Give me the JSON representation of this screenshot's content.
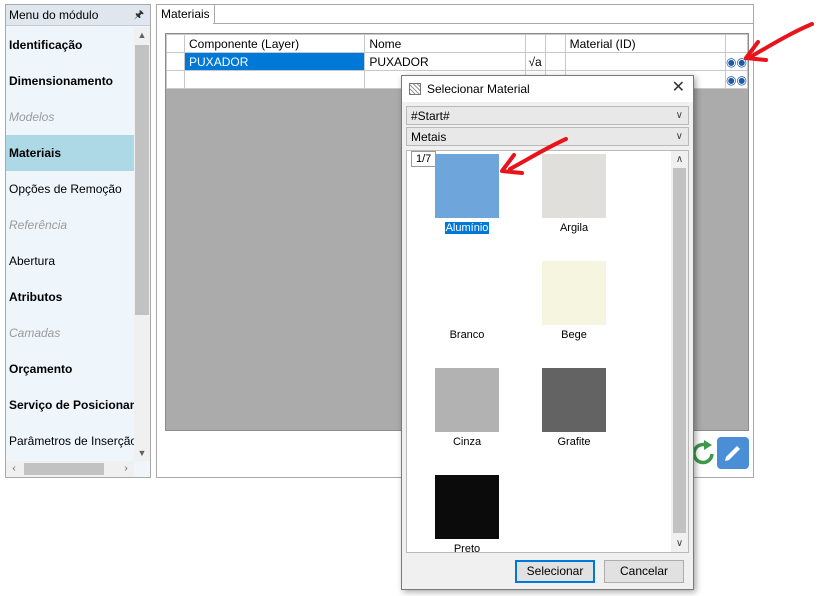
{
  "sidebar": {
    "title": "Menu do módulo",
    "items": [
      {
        "label": "Identificação",
        "style": "bold"
      },
      {
        "label": "Dimensionamento",
        "style": "bold"
      },
      {
        "label": "Modelos",
        "style": "disabled"
      },
      {
        "label": "Materiais",
        "style": "selected"
      },
      {
        "label": "Opções de Remoção",
        "style": "normal"
      },
      {
        "label": "Referência",
        "style": "disabled"
      },
      {
        "label": "Abertura",
        "style": "normal"
      },
      {
        "label": "Atributos",
        "style": "bold"
      },
      {
        "label": "Camadas",
        "style": "disabled"
      },
      {
        "label": "Orçamento",
        "style": "bold"
      },
      {
        "label": "Serviço de Posicionamento",
        "style": "bold"
      },
      {
        "label": "Parâmetros de Inserção",
        "style": "normal"
      }
    ]
  },
  "main": {
    "tab": "Materiais",
    "grid": {
      "columns": [
        "Componente (Layer)",
        "Nome",
        "",
        "",
        "Material (ID)",
        ""
      ],
      "rows": [
        {
          "component": "PUXADOR",
          "name": "PUXADOR",
          "material_id": ""
        }
      ]
    }
  },
  "dialog": {
    "title": "Selecionar Material",
    "combo1": "#Start#",
    "combo2": "Metais",
    "page_indicator": "1/7",
    "materials": [
      {
        "label": "Alumínio",
        "color": "#6ea6db",
        "selected": true
      },
      {
        "label": "Argila",
        "color": "#e0dfdc"
      },
      {
        "label": "Branco",
        "color": "#ffffff"
      },
      {
        "label": "Bege",
        "color": "#f5f5e0"
      },
      {
        "label": "Cinza",
        "color": "#b2b2b2"
      },
      {
        "label": "Grafite",
        "color": "#636363"
      },
      {
        "label": "Preto",
        "color": "#0b0b0b"
      }
    ],
    "select_button": "Selecionar",
    "cancel_button": "Cancelar"
  },
  "colors": {
    "selection": "#0078d7",
    "sidebar_selected": "#add8e6",
    "annotation_arrow": "#e8141c"
  }
}
